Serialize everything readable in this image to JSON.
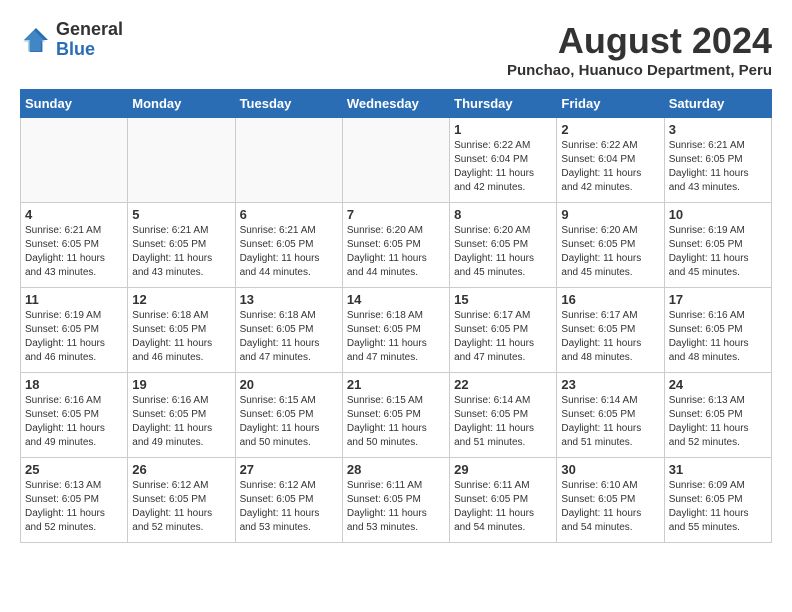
{
  "header": {
    "logo_general": "General",
    "logo_blue": "Blue",
    "month_year": "August 2024",
    "location": "Punchao, Huanuco Department, Peru"
  },
  "days_of_week": [
    "Sunday",
    "Monday",
    "Tuesday",
    "Wednesday",
    "Thursday",
    "Friday",
    "Saturday"
  ],
  "weeks": [
    [
      {
        "day": "",
        "empty": true
      },
      {
        "day": "",
        "empty": true
      },
      {
        "day": "",
        "empty": true
      },
      {
        "day": "",
        "empty": true
      },
      {
        "day": "1",
        "sunrise": "6:22 AM",
        "sunset": "6:04 PM",
        "daylight": "11 hours and 42 minutes."
      },
      {
        "day": "2",
        "sunrise": "6:22 AM",
        "sunset": "6:04 PM",
        "daylight": "11 hours and 42 minutes."
      },
      {
        "day": "3",
        "sunrise": "6:21 AM",
        "sunset": "6:05 PM",
        "daylight": "11 hours and 43 minutes."
      }
    ],
    [
      {
        "day": "4",
        "sunrise": "6:21 AM",
        "sunset": "6:05 PM",
        "daylight": "11 hours and 43 minutes."
      },
      {
        "day": "5",
        "sunrise": "6:21 AM",
        "sunset": "6:05 PM",
        "daylight": "11 hours and 43 minutes."
      },
      {
        "day": "6",
        "sunrise": "6:21 AM",
        "sunset": "6:05 PM",
        "daylight": "11 hours and 44 minutes."
      },
      {
        "day": "7",
        "sunrise": "6:20 AM",
        "sunset": "6:05 PM",
        "daylight": "11 hours and 44 minutes."
      },
      {
        "day": "8",
        "sunrise": "6:20 AM",
        "sunset": "6:05 PM",
        "daylight": "11 hours and 45 minutes."
      },
      {
        "day": "9",
        "sunrise": "6:20 AM",
        "sunset": "6:05 PM",
        "daylight": "11 hours and 45 minutes."
      },
      {
        "day": "10",
        "sunrise": "6:19 AM",
        "sunset": "6:05 PM",
        "daylight": "11 hours and 45 minutes."
      }
    ],
    [
      {
        "day": "11",
        "sunrise": "6:19 AM",
        "sunset": "6:05 PM",
        "daylight": "11 hours and 46 minutes."
      },
      {
        "day": "12",
        "sunrise": "6:18 AM",
        "sunset": "6:05 PM",
        "daylight": "11 hours and 46 minutes."
      },
      {
        "day": "13",
        "sunrise": "6:18 AM",
        "sunset": "6:05 PM",
        "daylight": "11 hours and 47 minutes."
      },
      {
        "day": "14",
        "sunrise": "6:18 AM",
        "sunset": "6:05 PM",
        "daylight": "11 hours and 47 minutes."
      },
      {
        "day": "15",
        "sunrise": "6:17 AM",
        "sunset": "6:05 PM",
        "daylight": "11 hours and 47 minutes."
      },
      {
        "day": "16",
        "sunrise": "6:17 AM",
        "sunset": "6:05 PM",
        "daylight": "11 hours and 48 minutes."
      },
      {
        "day": "17",
        "sunrise": "6:16 AM",
        "sunset": "6:05 PM",
        "daylight": "11 hours and 48 minutes."
      }
    ],
    [
      {
        "day": "18",
        "sunrise": "6:16 AM",
        "sunset": "6:05 PM",
        "daylight": "11 hours and 49 minutes."
      },
      {
        "day": "19",
        "sunrise": "6:16 AM",
        "sunset": "6:05 PM",
        "daylight": "11 hours and 49 minutes."
      },
      {
        "day": "20",
        "sunrise": "6:15 AM",
        "sunset": "6:05 PM",
        "daylight": "11 hours and 50 minutes."
      },
      {
        "day": "21",
        "sunrise": "6:15 AM",
        "sunset": "6:05 PM",
        "daylight": "11 hours and 50 minutes."
      },
      {
        "day": "22",
        "sunrise": "6:14 AM",
        "sunset": "6:05 PM",
        "daylight": "11 hours and 51 minutes."
      },
      {
        "day": "23",
        "sunrise": "6:14 AM",
        "sunset": "6:05 PM",
        "daylight": "11 hours and 51 minutes."
      },
      {
        "day": "24",
        "sunrise": "6:13 AM",
        "sunset": "6:05 PM",
        "daylight": "11 hours and 52 minutes."
      }
    ],
    [
      {
        "day": "25",
        "sunrise": "6:13 AM",
        "sunset": "6:05 PM",
        "daylight": "11 hours and 52 minutes."
      },
      {
        "day": "26",
        "sunrise": "6:12 AM",
        "sunset": "6:05 PM",
        "daylight": "11 hours and 52 minutes."
      },
      {
        "day": "27",
        "sunrise": "6:12 AM",
        "sunset": "6:05 PM",
        "daylight": "11 hours and 53 minutes."
      },
      {
        "day": "28",
        "sunrise": "6:11 AM",
        "sunset": "6:05 PM",
        "daylight": "11 hours and 53 minutes."
      },
      {
        "day": "29",
        "sunrise": "6:11 AM",
        "sunset": "6:05 PM",
        "daylight": "11 hours and 54 minutes."
      },
      {
        "day": "30",
        "sunrise": "6:10 AM",
        "sunset": "6:05 PM",
        "daylight": "11 hours and 54 minutes."
      },
      {
        "day": "31",
        "sunrise": "6:09 AM",
        "sunset": "6:05 PM",
        "daylight": "11 hours and 55 minutes."
      }
    ]
  ],
  "labels": {
    "sunrise": "Sunrise:",
    "sunset": "Sunset:",
    "daylight": "Daylight:"
  }
}
